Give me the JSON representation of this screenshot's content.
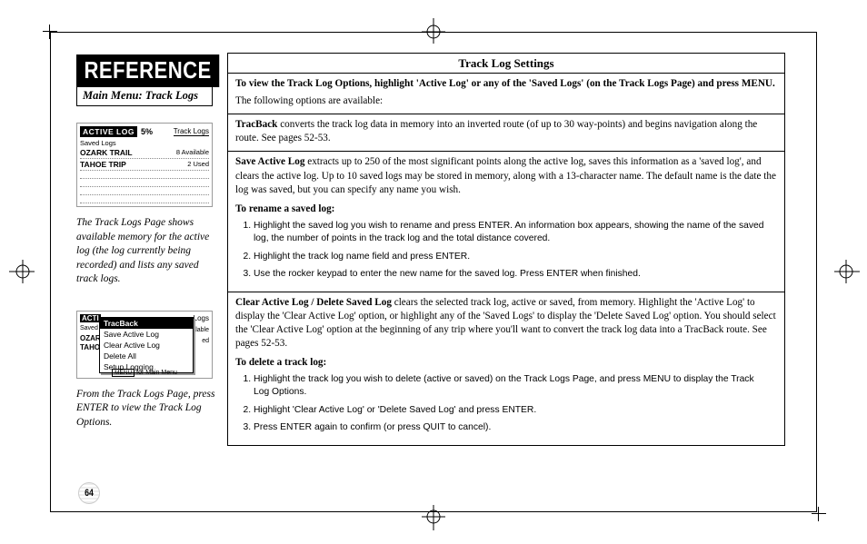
{
  "header": {
    "reference": "REFERENCE",
    "breadcrumb": "Main Menu: Track Logs"
  },
  "sidebar": {
    "screenshot1": {
      "active_label": "ACTIVE LOG",
      "percent": "5%",
      "tracklogs_label": "Track Logs",
      "saved_label": "Saved Logs",
      "row1": "OZARK TRAIL",
      "row1_status": "8  Available",
      "row2": "TAHOE TRIP",
      "row2_status": "2  Used"
    },
    "caption1": "The Track Logs Page shows available memory for the active log (the log currently being recorded) and lists any saved track logs.",
    "screenshot2": {
      "bg_left1": "ACTI",
      "bg_left2": "Saved",
      "bg_left3": "OZAR",
      "bg_left4": "TAHO",
      "bg_right1": "Logs",
      "bg_right2": "alable",
      "bg_right3": "ed",
      "menu_item1": "TracBack",
      "menu_item2": "Save Active Log",
      "menu_item3": "Clear Active Log",
      "menu_item4": "Delete All",
      "menu_item5": "Setup Logging",
      "foot_key": "MENU",
      "foot_text": " for Main Menu"
    },
    "caption2": "From the Track Logs Page, press ENTER to view the Track Log Options."
  },
  "main": {
    "title": "Track Log Settings",
    "intro_bold": "To view the Track Log Options, highlight 'Active Log' or any of the 'Saved Logs' (on the Track Logs Page) and press MENU.",
    "intro_follow": "The following options are available:",
    "tracback_term": "TracBack",
    "tracback_body": " converts the track log data in memory into an inverted route (of up to 30 way-points) and begins navigation along the route. See pages 52-53.",
    "save_term": "Save Active Log",
    "save_body": " extracts up to 250 of the most significant points along the active log, saves this information as a 'saved log', and clears the active log. Up to 10 saved logs may be stored in memory, along with a 13-character name. The default name is the date the log was saved, but you can specify any name you wish.",
    "rename_head": "To rename a saved log:",
    "rename_steps": [
      "Highlight the saved log you wish to rename and press ENTER. An information box appears, showing the name of the saved log, the number of points in the track log and the total distance covered.",
      "Highlight the track log name field and press ENTER.",
      "Use the rocker keypad to enter the new name for the saved log. Press ENTER when finished."
    ],
    "clear_term": "Clear Active Log / Delete Saved Log",
    "clear_body": " clears the selected track log, active or saved, from memory. Highlight the 'Active Log' to display the 'Clear Active Log' option, or highlight any of the 'Saved Logs' to display the 'Delete Saved Log' option. You should select the 'Clear Active Log' option at the beginning of any trip where you'll want to convert the track log data into a TracBack route. See pages 52-53.",
    "delete_head": "To delete a track log:",
    "delete_steps": [
      "Highlight the track log you wish to delete (active or saved) on the Track Logs Page, and press MENU to display the Track Log Options.",
      "Highlight 'Clear Active Log' or 'Delete Saved Log' and press ENTER.",
      "Press ENTER again to confirm (or press QUIT to cancel)."
    ]
  },
  "page_number": "64"
}
